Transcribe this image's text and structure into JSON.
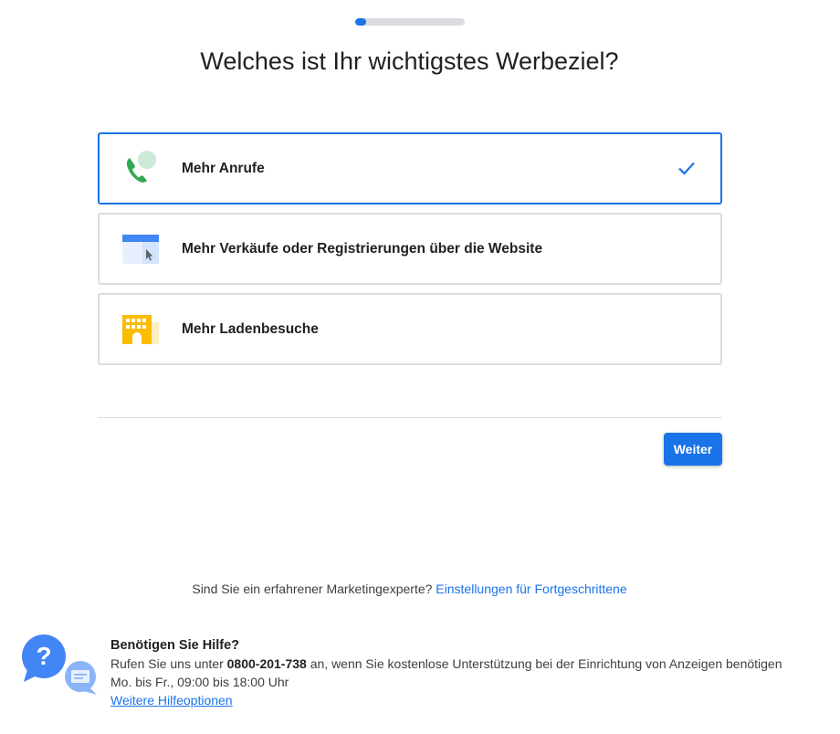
{
  "progress": {
    "value": 0.1
  },
  "page": {
    "title": "Welches ist Ihr wichtigstes Werbeziel?"
  },
  "options": [
    {
      "label": "Mehr Anrufe",
      "icon": "phone-chat-icon",
      "selected": true
    },
    {
      "label": "Mehr Verkäufe oder Registrierungen über die Website",
      "icon": "website-cursor-icon",
      "selected": false
    },
    {
      "label": "Mehr Ladenbesuche",
      "icon": "store-building-icon",
      "selected": false
    }
  ],
  "actions": {
    "next_label": "Weiter"
  },
  "advanced": {
    "question": "Sind Sie ein erfahrener Marketingexperte?",
    "link_label": "Einstellungen für Fortgeschrittene"
  },
  "help": {
    "title": "Benötigen Sie Hilfe?",
    "text_before": "Rufen Sie uns unter",
    "phone": "0800-201-738",
    "text_after": "an, wenn Sie kostenlose Unterstützung bei der Einrichtung von Anzeigen benötigen",
    "hours": "Mo. bis Fr., 09:00 bis 18:00 Uhr",
    "link_label": "Weitere Hilfeoptionen",
    "icon": "help-chat-icon"
  },
  "colors": {
    "accent": "#1a73e8",
    "border": "#dadce0",
    "text": "#202124",
    "phone_green": "#34a853",
    "store_yellow": "#fbbc04"
  }
}
